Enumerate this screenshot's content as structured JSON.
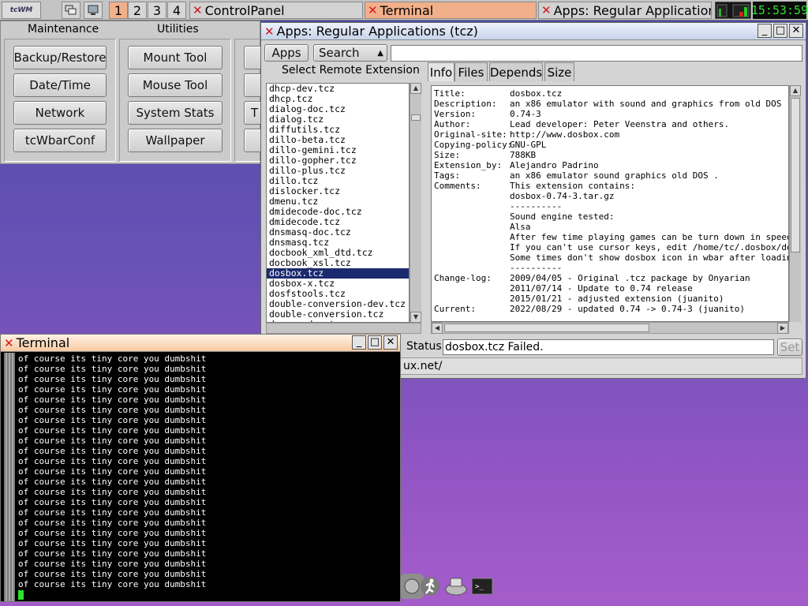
{
  "taskbar": {
    "logo": "tcWM",
    "workspaces": [
      "1",
      "2",
      "3",
      "4"
    ],
    "tasks": [
      {
        "label": "ControlPanel",
        "active": false
      },
      {
        "label": "Terminal",
        "active": true
      },
      {
        "label": "Apps: Regular Application...",
        "active": false
      }
    ],
    "clock": "15:53:59"
  },
  "control_panel": {
    "headers": [
      "Maintenance",
      "Utilities"
    ],
    "maintenance": [
      "Backup/Restore",
      "Date/Time",
      "Network",
      "tcWbarConf"
    ],
    "utilities": [
      "Mount Tool",
      "Mouse Tool",
      "System Stats",
      "Wallpaper"
    ],
    "partial_label": "T"
  },
  "apps": {
    "title": "Apps: Regular Applications (tcz)",
    "apps_btn": "Apps",
    "search_select": "Search",
    "search_value": "",
    "list_header": "Select Remote Extension",
    "list": [
      "dhcp-dev.tcz",
      "dhcp.tcz",
      "dialog-doc.tcz",
      "dialog.tcz",
      "diffutils.tcz",
      "dillo-beta.tcz",
      "dillo-gemini.tcz",
      "dillo-gopher.tcz",
      "dillo-plus.tcz",
      "dillo.tcz",
      "dislocker.tcz",
      "dmenu.tcz",
      "dmidecode-doc.tcz",
      "dmidecode.tcz",
      "dnsmasq-doc.tcz",
      "dnsmasq.tcz",
      "docbook_xml_dtd.tcz",
      "docbook_xsl.tcz",
      "dosbox.tcz",
      "dosbox-x.tcz",
      "dosfstools.tcz",
      "double-conversion-dev.tcz",
      "double-conversion.tcz",
      "dosemu-doc.tcz"
    ],
    "selected_item": "dosbox.tcz",
    "tabs": [
      "Info",
      "Files",
      "Depends",
      "Size"
    ],
    "info_rows": [
      {
        "k": "Title:",
        "v": "dosbox.tcz"
      },
      {
        "k": "Description:",
        "v": "an x86 emulator with sound and graphics from old DOS"
      },
      {
        "k": "Version:",
        "v": "0.74-3"
      },
      {
        "k": "Author:",
        "v": "Lead developer: Peter Veenstra and others."
      },
      {
        "k": "Original-site:",
        "v": "http://www.dosbox.com"
      },
      {
        "k": "Copying-policy:",
        "v": "GNU-GPL"
      },
      {
        "k": "Size:",
        "v": "788KB"
      },
      {
        "k": "Extension_by:",
        "v": "Alejandro Padrino"
      },
      {
        "k": "Tags:",
        "v": "an x86 emulator sound graphics old DOS ."
      },
      {
        "k": "Comments:",
        "v": "This extension contains:"
      },
      {
        "k": "",
        "v": "dosbox-0.74-3.tar.gz"
      },
      {
        "k": "",
        "v": "----------"
      },
      {
        "k": "",
        "v": "Sound engine tested:"
      },
      {
        "k": "",
        "v": "Alsa"
      },
      {
        "k": "",
        "v": "After few time playing games can be turn down in speed (sa"
      },
      {
        "k": "",
        "v": "If you can't use cursor keys, edit /home/tc/.dosbox/dosbox"
      },
      {
        "k": "",
        "v": "Some times don't show dosbox icon in wbar after loading."
      },
      {
        "k": "",
        "v": "----------"
      },
      {
        "k": "Change-log:",
        "v": "2009/04/05 - Original .tcz package by Onyarian"
      },
      {
        "k": "",
        "v": "2011/07/14 - Update to 0.74 release"
      },
      {
        "k": "",
        "v": "2015/01/21 - adjusted extension (juanito)"
      },
      {
        "k": "Current:",
        "v": "2022/08/29 - updated 0.74 -> 0.74-3 (juanito)"
      }
    ],
    "status_label": "Status",
    "status_value": "dosbox.tcz Failed.",
    "set_btn": "Set",
    "mirror_partial": "ux.net/"
  },
  "terminal": {
    "title": "Terminal",
    "lines": [
      "of course its tiny core you dumbshit",
      "of course its tiny core you dumbshit",
      "of course its tiny core you dumbshit",
      "of course its tiny core you dumbshit",
      "of course its tiny core you dumbshit",
      "of course its tiny core you dumbshit",
      "of course its tiny core you dumbshit",
      "of course its tiny core you dumbshit",
      "of course its tiny core you dumbshit",
      "of course its tiny core you dumbshit",
      "of course its tiny core you dumbshit",
      "of course its tiny core you dumbshit",
      "of course its tiny core you dumbshit",
      "of course its tiny core you dumbshit",
      "of course its tiny core you dumbshit",
      "of course its tiny core you dumbshit",
      "of course its tiny core you dumbshit",
      "of course its tiny core you dumbshit",
      "of course its tiny core you dumbshit",
      "of course its tiny core you dumbshit",
      "of course its tiny core you dumbshit",
      "of course its tiny core you dumbshit",
      "of course its tiny core you dumbshit"
    ]
  },
  "colors": {
    "accent": "#f2b08a",
    "selection": "#1b2a6e",
    "clock": "#2ee02e"
  }
}
